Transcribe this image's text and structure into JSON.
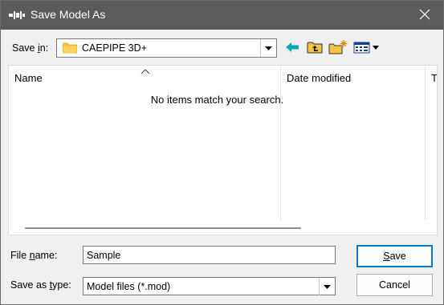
{
  "window": {
    "title": "Save Model As",
    "title_icon": "app-icon",
    "close_icon": "close-icon",
    "titlebar_color": "#5b5b5b"
  },
  "toolbar": {
    "save_in_label_prefix": "Save ",
    "save_in_label_accel": "i",
    "save_in_label_suffix": "n:",
    "save_in_value": "CAEPIPE 3D+",
    "buttons": [
      "back-icon",
      "up-folder-icon",
      "new-folder-icon",
      "view-menu-icon"
    ]
  },
  "filelist": {
    "columns": [
      "Name",
      "Date modified",
      "T"
    ],
    "empty_message": "No items match your search."
  },
  "form": {
    "file_name_label_prefix": "File ",
    "file_name_label_accel": "n",
    "file_name_label_suffix": "ame:",
    "file_name_value": "Sample",
    "save_as_type_label_prefix": "Save as ",
    "save_as_type_label_accel": "t",
    "save_as_type_label_suffix": "ype:",
    "save_as_type_value": "Model files (*.mod)"
  },
  "buttons": {
    "save_accel": "S",
    "save_rest": "ave",
    "cancel": "Cancel"
  },
  "colors": {
    "accent": "#0078d7",
    "folder": "#f6c244"
  }
}
